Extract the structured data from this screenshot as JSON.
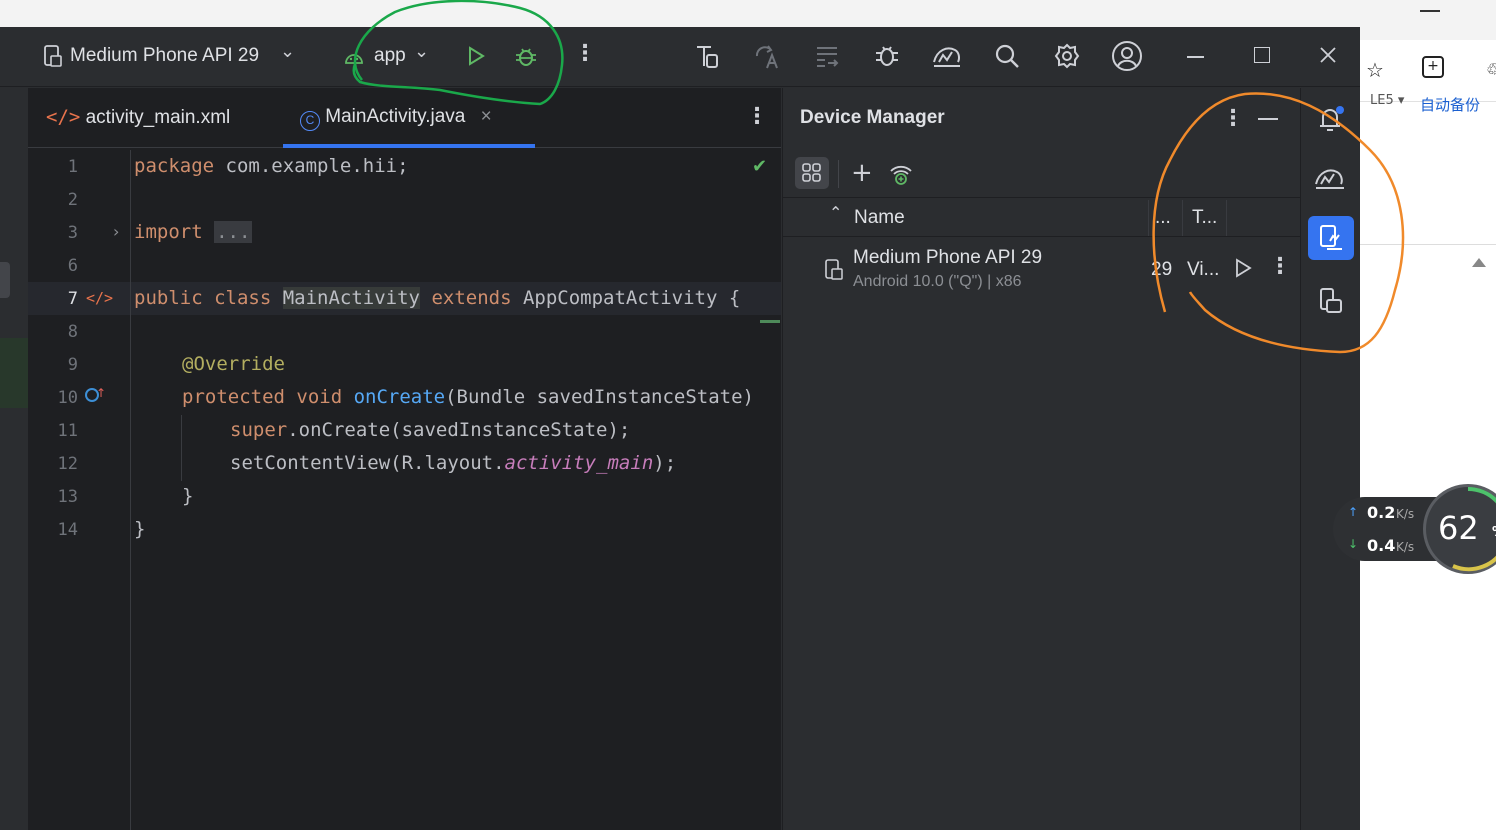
{
  "toolbar": {
    "device": "Medium Phone API 29",
    "config": "app"
  },
  "tabs": [
    {
      "label": "activity_main.xml",
      "active": false
    },
    {
      "label": "MainActivity.java",
      "active": true
    }
  ],
  "editor": {
    "lines": [
      {
        "n": "1",
        "text": "package com.example.hii;"
      },
      {
        "n": "2",
        "text": ""
      },
      {
        "n": "3",
        "text": "import ..."
      },
      {
        "n": "6",
        "text": ""
      },
      {
        "n": "7",
        "text": "public class MainActivity extends AppCompatActivity {"
      },
      {
        "n": "8",
        "text": ""
      },
      {
        "n": "9",
        "text": "@Override"
      },
      {
        "n": "10",
        "text": "protected void onCreate(Bundle savedInstanceState)"
      },
      {
        "n": "11",
        "text": "super.onCreate(savedInstanceState);"
      },
      {
        "n": "12",
        "text": "setContentView(R.layout.activity_main);"
      },
      {
        "n": "13",
        "text": "}"
      },
      {
        "n": "14",
        "text": "}"
      }
    ]
  },
  "device_manager": {
    "title": "Device Manager",
    "columns": {
      "name": "Name",
      "api": "...",
      "type": "T..."
    },
    "devices": [
      {
        "name": "Medium Phone API 29",
        "sub": "Android 10.0 (\"Q\") | x86",
        "api": "29",
        "type": "Vi..."
      }
    ]
  },
  "background_app": {
    "label_partial": "LE5 ▾",
    "chinese_label": "自动备份"
  },
  "net_widget": {
    "up": "0.2",
    "down": "0.4",
    "unit": "K/s",
    "percent": "62",
    "percent_sign": "%"
  },
  "colors": {
    "accent": "#3574f0",
    "run_green": "#5fb865",
    "annotation_green": "#1aa84a",
    "annotation_orange": "#f08a2b"
  }
}
